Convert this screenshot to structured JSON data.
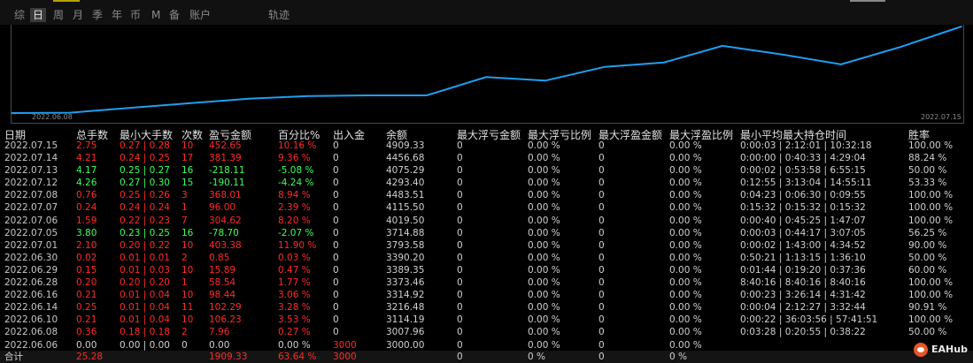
{
  "tabs": [
    "综",
    "日",
    "周",
    "月",
    "季",
    "年",
    "币",
    "M",
    "备",
    "账户",
    "轨迹"
  ],
  "active_tab": "日",
  "chart_data": {
    "type": "line",
    "x": [
      "2022.06.06",
      "2022.06.08",
      "2022.06.10",
      "2022.06.14",
      "2022.06.16",
      "2022.06.28",
      "2022.06.29",
      "2022.06.30",
      "2022.07.01",
      "2022.07.05",
      "2022.07.06",
      "2022.07.07",
      "2022.07.08",
      "2022.07.12",
      "2022.07.13",
      "2022.07.14",
      "2022.07.15"
    ],
    "series": [
      {
        "values": [
          3000.0,
          3007.96,
          3114.19,
          3216.48,
          3314.92,
          3373.46,
          3389.35,
          3390.2,
          3793.58,
          3714.88,
          4019.5,
          4115.5,
          4483.51,
          4293.4,
          4075.29,
          4456.68,
          4909.33
        ]
      }
    ],
    "x_start_label": "2022.06.08",
    "x_end_label": "2022.07.15",
    "line_color": "#1e9ff0"
  },
  "table": {
    "headers": [
      "日期",
      "总手数",
      "最小大手数",
      "次数",
      "盈亏金额",
      "百分比%",
      "出入金",
      "余额",
      "最大浮亏金额",
      "最大浮亏比例",
      "最大浮盈金额",
      "最大浮盈比例",
      "最小平均最大持仓时间",
      "胜率"
    ],
    "rows": [
      {
        "tone": "red",
        "cells": [
          "2022.07.15",
          "2.75",
          "0.27 | 0.28",
          "10",
          "452.65",
          "10.16 %",
          "0",
          "4909.33",
          "0",
          "0.00 %",
          "0",
          "0.00 %",
          "0:00:03 | 2:12:01 | 10:32:18",
          "100.00 %"
        ]
      },
      {
        "tone": "red",
        "cells": [
          "2022.07.14",
          "4.21",
          "0.24 | 0.25",
          "17",
          "381.39",
          "9.36 %",
          "0",
          "4456.68",
          "0",
          "0.00 %",
          "0",
          "0.00 %",
          "0:00:00 | 0:40:33 | 4:29:04",
          "88.24 %"
        ]
      },
      {
        "tone": "grn",
        "cells": [
          "2022.07.13",
          "4.17",
          "0.25 | 0.27",
          "16",
          "-218.11",
          "-5.08 %",
          "0",
          "4075.29",
          "0",
          "0.00 %",
          "0",
          "0.00 %",
          "0:00:02 | 0:53:58 | 6:55:15",
          "50.00 %"
        ]
      },
      {
        "tone": "grn",
        "cells": [
          "2022.07.12",
          "4.26",
          "0.27 | 0.30",
          "15",
          "-190.11",
          "-4.24 %",
          "0",
          "4293.40",
          "0",
          "0.00 %",
          "0",
          "0.00 %",
          "0:12:55 | 3:13:04 | 14:55:11",
          "53.33 %"
        ]
      },
      {
        "tone": "red",
        "cells": [
          "2022.07.08",
          "0.76",
          "0.25 | 0.26",
          "3",
          "368.01",
          "8.94 %",
          "0",
          "4483.51",
          "0",
          "0.00 %",
          "0",
          "0.00 %",
          "0:04:23 | 0:06:30 | 0:09:55",
          "100.00 %"
        ]
      },
      {
        "tone": "red",
        "cells": [
          "2022.07.07",
          "0.24",
          "0.24 | 0.24",
          "1",
          "96.00",
          "2.39 %",
          "0",
          "4115.50",
          "0",
          "0.00 %",
          "0",
          "0.00 %",
          "0:15:32 | 0:15:32 | 0:15:32",
          "100.00 %"
        ]
      },
      {
        "tone": "red",
        "cells": [
          "2022.07.06",
          "1.59",
          "0.22 | 0.23",
          "7",
          "304.62",
          "8.20 %",
          "0",
          "4019.50",
          "0",
          "0.00 %",
          "0",
          "0.00 %",
          "0:00:40 | 0:45:25 | 1:47:07",
          "100.00 %"
        ]
      },
      {
        "tone": "grn",
        "cells": [
          "2022.07.05",
          "3.80",
          "0.23 | 0.25",
          "16",
          "-78.70",
          "-2.07 %",
          "0",
          "3714.88",
          "0",
          "0.00 %",
          "0",
          "0.00 %",
          "0:00:03 | 0:44:17 | 3:07:05",
          "56.25 %"
        ]
      },
      {
        "tone": "red",
        "cells": [
          "2022.07.01",
          "2.10",
          "0.20 | 0.22",
          "10",
          "403.38",
          "11.90 %",
          "0",
          "3793.58",
          "0",
          "0.00 %",
          "0",
          "0.00 %",
          "0:00:02 | 1:43:00 | 4:34:52",
          "90.00 %"
        ]
      },
      {
        "tone": "red",
        "cells": [
          "2022.06.30",
          "0.02",
          "0.01 | 0.01",
          "2",
          "0.85",
          "0.03 %",
          "0",
          "3390.20",
          "0",
          "0.00 %",
          "0",
          "0.00 %",
          "0:50:21 | 1:13:15 | 1:36:10",
          "50.00 %"
        ]
      },
      {
        "tone": "red",
        "cells": [
          "2022.06.29",
          "0.15",
          "0.01 | 0.03",
          "10",
          "15.89",
          "0.47 %",
          "0",
          "3389.35",
          "0",
          "0.00 %",
          "0",
          "0.00 %",
          "0:01:44 | 0:19:20 | 0:37:36",
          "60.00 %"
        ]
      },
      {
        "tone": "red",
        "cells": [
          "2022.06.28",
          "0.20",
          "0.20 | 0.20",
          "1",
          "58.54",
          "1.77 %",
          "0",
          "3373.46",
          "0",
          "0.00 %",
          "0",
          "0.00 %",
          "8:40:16 | 8:40:16 | 8:40:16",
          "100.00 %"
        ]
      },
      {
        "tone": "red",
        "cells": [
          "2022.06.16",
          "0.21",
          "0.01 | 0.04",
          "10",
          "98.44",
          "3.06 %",
          "0",
          "3314.92",
          "0",
          "0.00 %",
          "0",
          "0.00 %",
          "0:00:23 | 3:26:14 | 4:31:42",
          "100.00 %"
        ]
      },
      {
        "tone": "red",
        "cells": [
          "2022.06.14",
          "0.25",
          "0.01 | 0.04",
          "11",
          "102.29",
          "3.28 %",
          "0",
          "3216.48",
          "0",
          "0.00 %",
          "0",
          "0.00 %",
          "0:00:04 | 2:12:27 | 3:32:44",
          "90.91 %"
        ]
      },
      {
        "tone": "red",
        "cells": [
          "2022.06.10",
          "0.21",
          "0.01 | 0.04",
          "10",
          "106.23",
          "3.53 %",
          "0",
          "3114.19",
          "0",
          "0.00 %",
          "0",
          "0.00 %",
          "0:00:22 | 36:03:56 | 57:41:51",
          "100.00 %"
        ]
      },
      {
        "tone": "red",
        "cells": [
          "2022.06.08",
          "0.36",
          "0.18 | 0.18",
          "2",
          "7.96",
          "0.27 %",
          "0",
          "3007.96",
          "0",
          "0.00 %",
          "0",
          "0.00 %",
          "0:03:28 | 0:20:55 | 0:38:22",
          "50.00 %"
        ]
      },
      {
        "tone": "wht",
        "cells": [
          "2022.06.06",
          "0.00",
          "0.00 | 0.00",
          "0",
          "0.00",
          "0.00 %",
          "3000",
          "3000.00",
          "0",
          "0.00 %",
          "0",
          "0.00 %",
          "",
          ""
        ]
      }
    ],
    "total": {
      "label": "合计",
      "lots": "25.28",
      "pnl": "1909.33",
      "pct": "63.64 %",
      "flow": "3000",
      "c9": "0",
      "c10": "0 %",
      "c11": "0",
      "c12": "0 %"
    }
  },
  "logo": {
    "text": "EAHub"
  }
}
